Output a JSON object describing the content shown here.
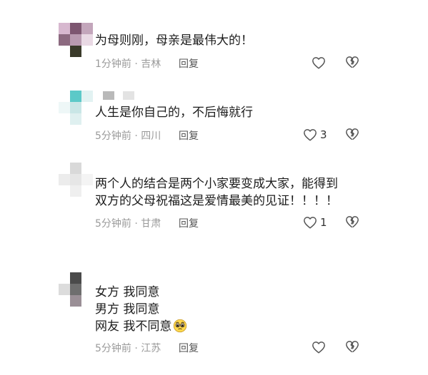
{
  "comments": [
    {
      "text_lines": [
        "为母则刚，母亲是最伟大的！"
      ],
      "time": "1分钟前",
      "location": "吉林",
      "reply_label": "回复",
      "like_count": "",
      "icons": {
        "like": "heart-outline-icon",
        "dislike": "broken-heart-icon"
      }
    },
    {
      "text_lines": [
        "人生是你自己的，不后悔就行"
      ],
      "time": "5分钟前",
      "location": "四川",
      "reply_label": "回复",
      "like_count": "3",
      "icons": {
        "like": "heart-outline-icon",
        "dislike": "broken-heart-icon"
      }
    },
    {
      "text_lines": [
        "两个人的结合是两个小家要变成大家，能得到",
        "双方的父母祝福这是爱情最美的见证！！！！"
      ],
      "time": "5分钟前",
      "location": "甘肃",
      "reply_label": "回复",
      "like_count": "1",
      "icons": {
        "like": "heart-outline-icon",
        "dislike": "broken-heart-icon"
      }
    },
    {
      "text_lines": [
        "女方 我同意",
        "男方 我同意",
        "网友 我不同意"
      ],
      "time": "5分钟前",
      "location": "江苏",
      "reply_label": "回复",
      "like_count": "",
      "icons": {
        "like": "heart-outline-icon",
        "dislike": "broken-heart-icon",
        "emoji": "pleading-face-emoji-icon"
      }
    }
  ],
  "meta_separator": "·",
  "colors": {
    "text": "#1c1c1c",
    "meta": "#9a9a9a",
    "reply": "#555555",
    "icon_stroke": "#555555",
    "background": "#ffffff"
  }
}
